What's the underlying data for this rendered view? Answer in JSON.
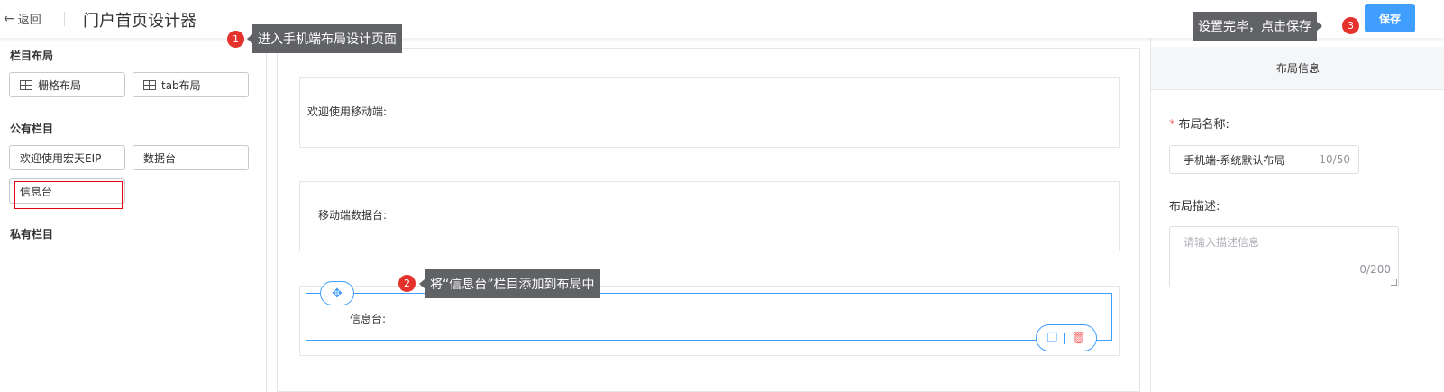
{
  "header": {
    "back_label": "返回",
    "title": "门户首页设计器",
    "save_label": "保存"
  },
  "left_panel": {
    "groups": [
      {
        "title": "栏目布局",
        "items": [
          "栅格布局",
          "tab布局"
        ]
      },
      {
        "title": "公有栏目",
        "items": [
          "欢迎使用宏天EIP",
          "数据台",
          "信息台"
        ]
      },
      {
        "title": "私有栏目",
        "items": []
      }
    ]
  },
  "canvas": {
    "slots": [
      {
        "label": "欢迎使用移动端:"
      },
      {
        "label": "移动端数据台:"
      },
      {
        "label": "信息台:"
      }
    ]
  },
  "right_panel": {
    "header": "布局信息",
    "name_label": "布局名称:",
    "name_value": "手机端-系统默认布局",
    "name_count": "10/50",
    "desc_label": "布局描述:",
    "desc_placeholder": "请输入描述信息",
    "desc_count": "0/200"
  },
  "annotations": [
    {
      "num": "1",
      "text": "进入手机端布局设计页面"
    },
    {
      "num": "2",
      "text": "将“信息台”栏目添加到布局中"
    },
    {
      "num": "3",
      "text": "设置完毕，点击保存"
    }
  ],
  "colors": {
    "primary": "#409eff",
    "badge": "#e5322d",
    "tooltip": "#606266",
    "highlight": "#e60012",
    "danger": "#f56c6c"
  },
  "icons": [
    "back-arrow-icon",
    "grid-layout-icon",
    "tab-layout-icon",
    "move-icon",
    "copy-icon",
    "delete-icon"
  ]
}
